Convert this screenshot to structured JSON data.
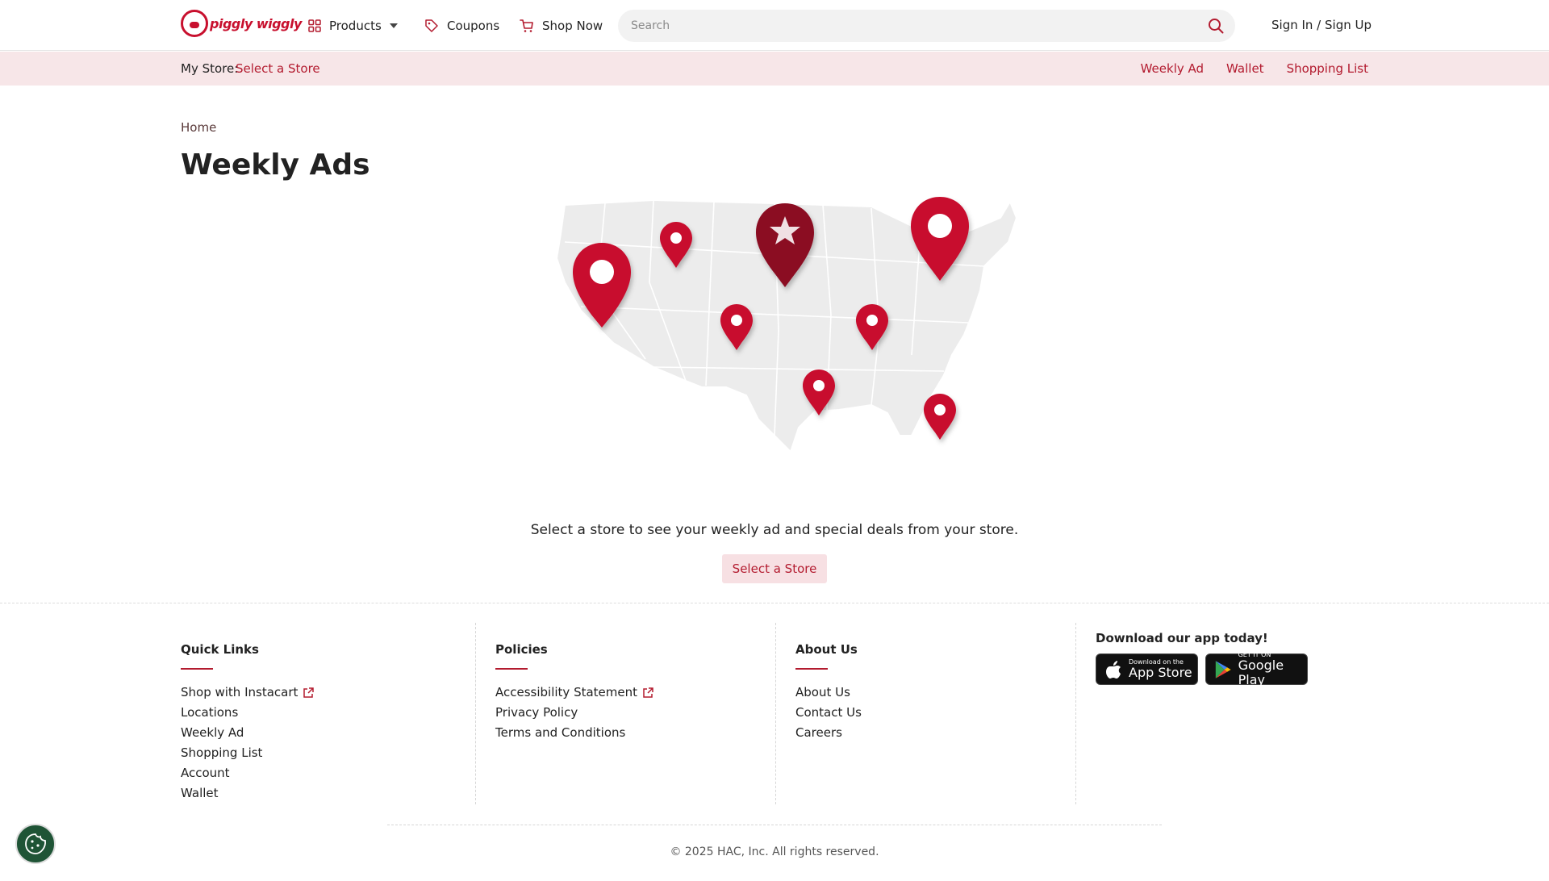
{
  "header": {
    "logo_text": "piggly wiggly",
    "nav": {
      "products": "Products",
      "coupons": "Coupons",
      "shop_now": "Shop Now"
    },
    "search": {
      "placeholder": "Search",
      "value": ""
    },
    "sign_in": "Sign In / Sign Up"
  },
  "store_bar": {
    "my_store_label": "My Store:",
    "select_store": "Select a Store",
    "links": [
      "Weekly Ad",
      "Wallet",
      "Shopping List"
    ]
  },
  "main": {
    "breadcrumb": "Home",
    "title": "Weekly Ads",
    "empty_message": "Select a store to see your weekly ad and special deals from your store.",
    "select_button": "Select a Store"
  },
  "footer": {
    "quick_links": {
      "title": "Quick Links",
      "items": [
        "Shop with Instacart",
        "Locations",
        "Weekly Ad",
        "Shopping List",
        "Account",
        "Wallet"
      ]
    },
    "policies": {
      "title": "Policies",
      "items": [
        "Accessibility Statement",
        "Privacy Policy",
        "Terms and Conditions"
      ]
    },
    "about": {
      "title": "About Us",
      "items": [
        "About Us",
        "Contact Us",
        "Careers"
      ]
    },
    "app": {
      "title": "Download our app today!",
      "app_store_small": "Download on the",
      "app_store_big": "App Store",
      "google_small": "GET IT ON",
      "google_big": "Google Play"
    },
    "copyright": "© 2025 HAC, Inc. All rights reserved."
  },
  "colors": {
    "brand_red": "#c8102e",
    "link_red": "#b31b2f",
    "store_bar_bg": "#f7e6e8",
    "cookie_green": "#1f5436"
  },
  "icons": [
    "grid-icon",
    "caret-down-icon",
    "tag-icon",
    "cart-icon",
    "search-icon",
    "external-link-icon",
    "apple-icon",
    "google-play-icon",
    "cookie-icon",
    "map-pin-icon",
    "star-pin-icon"
  ]
}
